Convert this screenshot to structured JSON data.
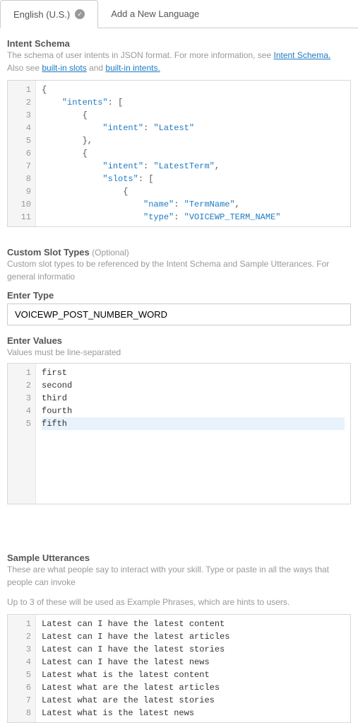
{
  "tabs": {
    "active": "English (U.S.)",
    "add": "Add a New Language"
  },
  "intent_schema": {
    "title": "Intent Schema",
    "desc_prefix": "The schema of user intents in JSON format. For more information, see ",
    "link1": "Intent Schema.",
    "desc2_prefix": "Also see ",
    "link2": "built-in slots",
    "desc2_mid": " and ",
    "link3": "built-in intents.",
    "json_lines": [
      {
        "t": "brace",
        "v": "{"
      },
      {
        "t": "kv",
        "indent": 2,
        "k": "\"intents\"",
        "v": ": ["
      },
      {
        "t": "brace",
        "indent": 4,
        "v": "{"
      },
      {
        "t": "kv2",
        "indent": 6,
        "k": "\"intent\"",
        "v": ": ",
        "s": "\"Latest\""
      },
      {
        "t": "brace",
        "indent": 4,
        "v": "},"
      },
      {
        "t": "brace",
        "indent": 4,
        "v": "{"
      },
      {
        "t": "kv2",
        "indent": 6,
        "k": "\"intent\"",
        "v": ": ",
        "s": "\"LatestTerm\"",
        "suf": ","
      },
      {
        "t": "kv",
        "indent": 6,
        "k": "\"slots\"",
        "v": ": ["
      },
      {
        "t": "brace",
        "indent": 8,
        "v": "{"
      },
      {
        "t": "kv2",
        "indent": 10,
        "k": "\"name\"",
        "v": ": ",
        "s": "\"TermName\"",
        "suf": ","
      },
      {
        "t": "kv2",
        "indent": 10,
        "k": "\"type\"",
        "v": ": ",
        "s": "\"VOICEWP_TERM_NAME\""
      }
    ]
  },
  "custom_slot": {
    "title": "Custom Slot Types",
    "optional": " (Optional)",
    "desc": "Custom slot types to be referenced by the Intent Schema and Sample Utterances. For general informatio",
    "enter_type_label": "Enter Type",
    "type_value": "VOICEWP_POST_NUMBER_WORD",
    "enter_values_label": "Enter Values",
    "values_desc": "Values must be line-separated",
    "values": [
      "first",
      "second",
      "third",
      "fourth",
      "fifth"
    ]
  },
  "utterances": {
    "title": "Sample Utterances",
    "desc": "These are what people say to interact with your skill. Type or paste in all the ways that people can invoke",
    "hint": "Up to 3 of these will be used as Example Phrases, which are hints to users.",
    "lines": [
      "Latest can I have the latest content",
      "Latest can I have the latest articles",
      "Latest can I have the latest stories",
      "Latest can I have the latest news",
      "Latest what is the latest content",
      "Latest what are the latest articles",
      "Latest what are the latest stories",
      "Latest what is the latest news"
    ]
  }
}
